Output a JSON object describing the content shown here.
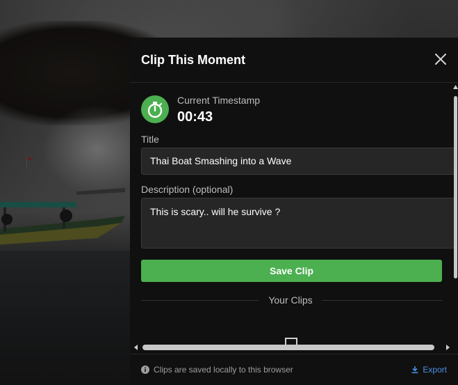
{
  "panel": {
    "title": "Clip This Moment",
    "close_icon": "close-icon"
  },
  "timestamp": {
    "icon": "stopwatch-icon",
    "label": "Current Timestamp",
    "value": "00:43"
  },
  "form": {
    "title_label": "Title",
    "title_value": "Thai Boat Smashing into a Wave",
    "description_label": "Description (optional)",
    "description_value": "This is scary.. will he survive ?",
    "save_label": "Save Clip"
  },
  "clips": {
    "heading": "Your Clips",
    "empty_icon": "clip-placeholder-icon"
  },
  "footer": {
    "note": "Clips are saved locally to this browser",
    "note_icon": "info-icon",
    "export_label": "Export",
    "export_icon": "download-icon"
  },
  "colors": {
    "accent": "#4caf50",
    "link": "#4a90e2",
    "panel_bg": "#101010",
    "input_bg": "#262626"
  }
}
